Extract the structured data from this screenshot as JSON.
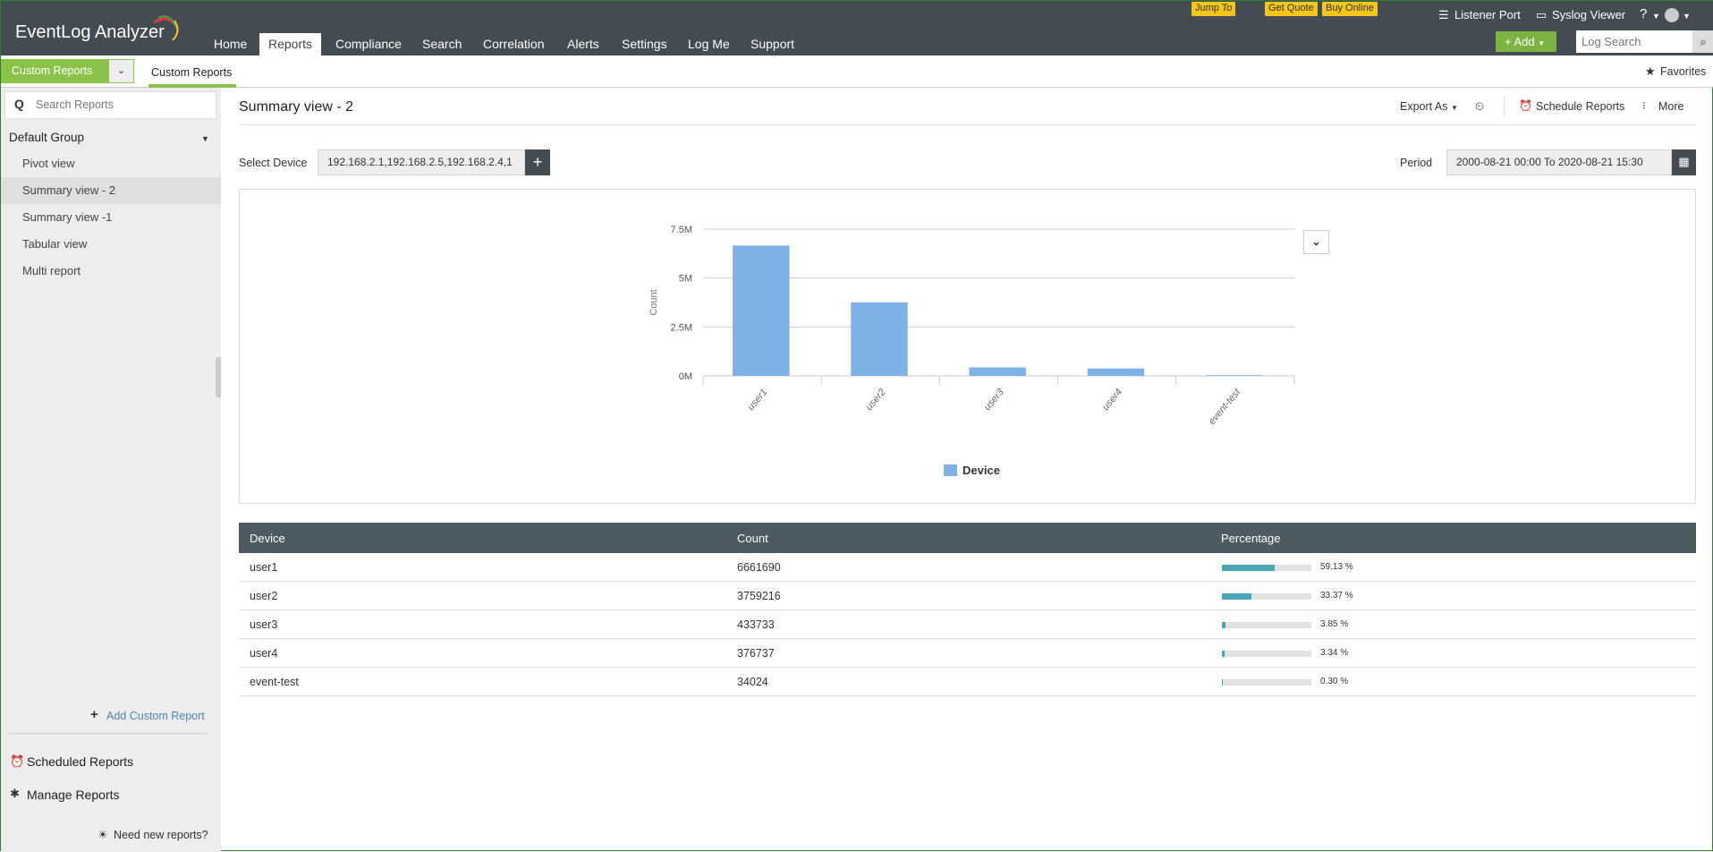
{
  "app": {
    "title": "EventLog Analyzer"
  },
  "topbar": {
    "jump_to": "Jump To",
    "get_quote": "Get Quote",
    "buy_online": "Buy Online",
    "listener_port": "Listener Port",
    "syslog_viewer": "Syslog Viewer",
    "help": "?",
    "add": "+ Add",
    "log_search_placeholder": "Log Search"
  },
  "nav": [
    "Home",
    "Reports",
    "Compliance",
    "Search",
    "Correlation",
    "Alerts",
    "Settings",
    "Log Me",
    "Support"
  ],
  "subheader": {
    "selector": "Custom Reports",
    "tab": "Custom Reports",
    "favorites": "Favorites"
  },
  "sidebar": {
    "search_placeholder": "Search Reports",
    "group": "Default Group",
    "items": [
      "Pivot view",
      "Summary view - 2",
      "Summary view -1",
      "Tabular view",
      "Multi report"
    ],
    "add_custom": "Add Custom Report",
    "scheduled": "Scheduled Reports",
    "manage": "Manage Reports",
    "need_new": "Need new reports?"
  },
  "main": {
    "title": "Summary view - 2",
    "export_as": "Export As",
    "schedule_reports": "Schedule Reports",
    "more": "More",
    "select_device_label": "Select Device",
    "select_device_value": "192.168.2.1,192.168.2.5,192.168.2.4,1",
    "period_label": "Period",
    "period_value": "2000-08-21 00:00 To 2020-08-21 15:30"
  },
  "chart_data": {
    "type": "bar",
    "categories": [
      "user1",
      "user2",
      "user3",
      "user4",
      "event-test"
    ],
    "values": [
      6661690,
      3759216,
      433733,
      376737,
      34024
    ],
    "ylabel": "Count",
    "yticks": [
      "0M",
      "2.5M",
      "5M",
      "7.5M"
    ],
    "ylim": [
      0,
      7500000
    ],
    "legend": "Device",
    "color": "#7eb2e6",
    "grid": true,
    "legend_position": "bottom"
  },
  "table": {
    "headers": [
      "Device",
      "Count",
      "Percentage"
    ],
    "rows": [
      {
        "device": "user1",
        "count": "6661690",
        "pct": 59.13,
        "pct_label": "59.13 %"
      },
      {
        "device": "user2",
        "count": "3759216",
        "pct": 33.37,
        "pct_label": "33.37 %"
      },
      {
        "device": "user3",
        "count": "433733",
        "pct": 3.85,
        "pct_label": "3.85 %"
      },
      {
        "device": "user4",
        "count": "376737",
        "pct": 3.34,
        "pct_label": "3.34 %"
      },
      {
        "device": "event-test",
        "count": "34024",
        "pct": 0.3,
        "pct_label": "0.30 %"
      }
    ]
  }
}
